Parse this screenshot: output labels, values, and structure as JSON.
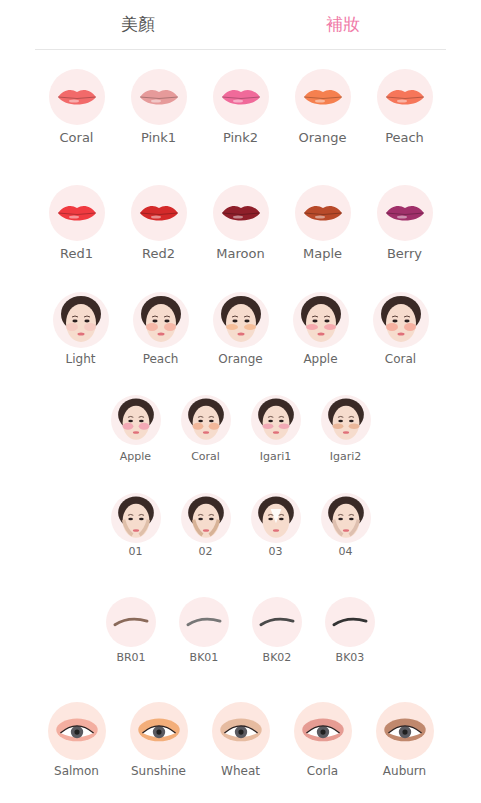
{
  "tabs": [
    {
      "label": "美顏",
      "selected": false
    },
    {
      "label": "補妝",
      "selected": true
    }
  ],
  "sections": [
    {
      "kind": "lip",
      "items": [
        {
          "label": "Coral",
          "color": "#f26a6a"
        },
        {
          "label": "Pink1",
          "color": "#e69a9a"
        },
        {
          "label": "Pink2",
          "color": "#f06a9a"
        },
        {
          "label": "Orange",
          "color": "#f5804f"
        },
        {
          "label": "Peach",
          "color": "#f6765a"
        }
      ]
    },
    {
      "kind": "lip",
      "items": [
        {
          "label": "Red1",
          "color": "#f03a40"
        },
        {
          "label": "Red2",
          "color": "#d42a2a"
        },
        {
          "label": "Maroon",
          "color": "#8f1f2a"
        },
        {
          "label": "Maple",
          "color": "#b84a2a"
        },
        {
          "label": "Berry",
          "color": "#a0306a"
        }
      ]
    },
    {
      "kind": "blush",
      "items": [
        {
          "label": "Light",
          "color": "#f5c8c0"
        },
        {
          "label": "Peach",
          "color": "#f5b0a0"
        },
        {
          "label": "Orange",
          "color": "#f5b890"
        },
        {
          "label": "Apple",
          "color": "#f5a0a8"
        },
        {
          "label": "Coral",
          "color": "#f5a898"
        }
      ]
    },
    {
      "kind": "blush",
      "items": [
        {
          "label": "Apple",
          "color": "#f2a0b0"
        },
        {
          "label": "Coral",
          "color": "#f0b090"
        },
        {
          "label": "Igari1",
          "color": "#f0a0b0"
        },
        {
          "label": "Igari2",
          "color": "#e8b090"
        }
      ]
    },
    {
      "kind": "contour",
      "items": [
        {
          "label": "01",
          "color": "#d9b8a0"
        },
        {
          "label": "02",
          "color": "#d0a888"
        },
        {
          "label": "03",
          "color": "#ffffff"
        },
        {
          "label": "04",
          "color": "#d8b8a8"
        }
      ]
    },
    {
      "kind": "brow",
      "items": [
        {
          "label": "BR01",
          "color": "#8a6a5a"
        },
        {
          "label": "BK01",
          "color": "#777777"
        },
        {
          "label": "BK02",
          "color": "#4a4a4a"
        },
        {
          "label": "BK03",
          "color": "#333333"
        }
      ]
    },
    {
      "kind": "eye",
      "items": [
        {
          "label": "Salmon",
          "color": "#f0a090"
        },
        {
          "label": "Sunshine",
          "color": "#f0a060"
        },
        {
          "label": "Wheat",
          "color": "#e0b090"
        },
        {
          "label": "Corla",
          "color": "#e08a80"
        },
        {
          "label": "Auburn",
          "color": "#b07050"
        }
      ]
    }
  ]
}
